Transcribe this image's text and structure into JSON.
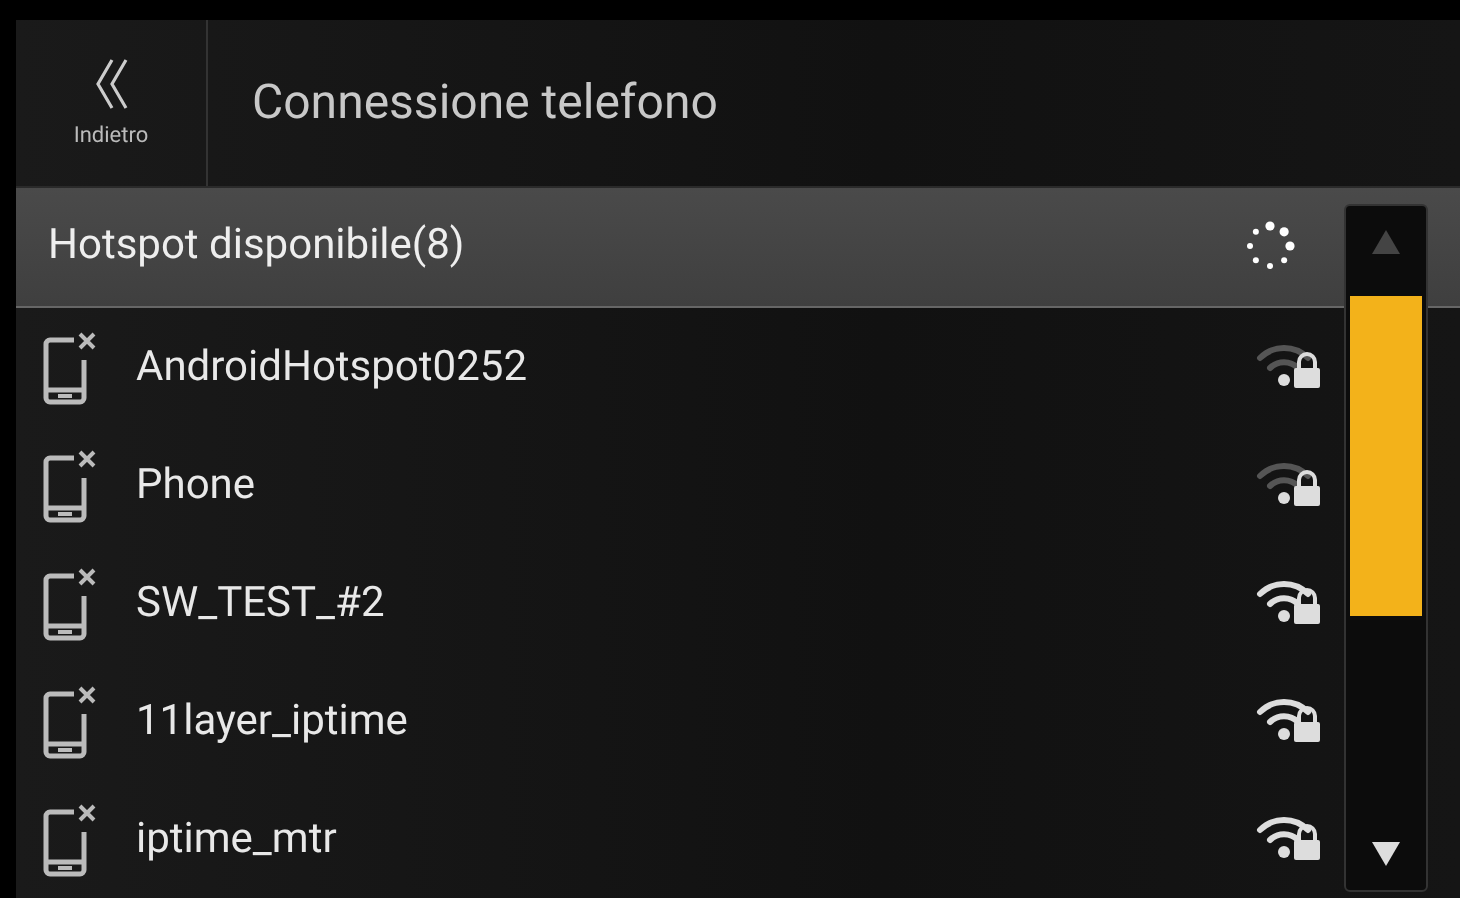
{
  "header": {
    "back_label": "Indietro",
    "title": "Connessione telefono"
  },
  "list_header": {
    "title": "Hotspot disponibile(8)"
  },
  "hotspots": [
    {
      "name": "AndroidHotspot0252",
      "kind": "weak"
    },
    {
      "name": "Phone",
      "kind": "weak"
    },
    {
      "name": "SW_TEST_#2",
      "kind": "strong"
    },
    {
      "name": "11layer_iptime",
      "kind": "strong"
    },
    {
      "name": "iptime_mtr",
      "kind": "strong"
    }
  ]
}
